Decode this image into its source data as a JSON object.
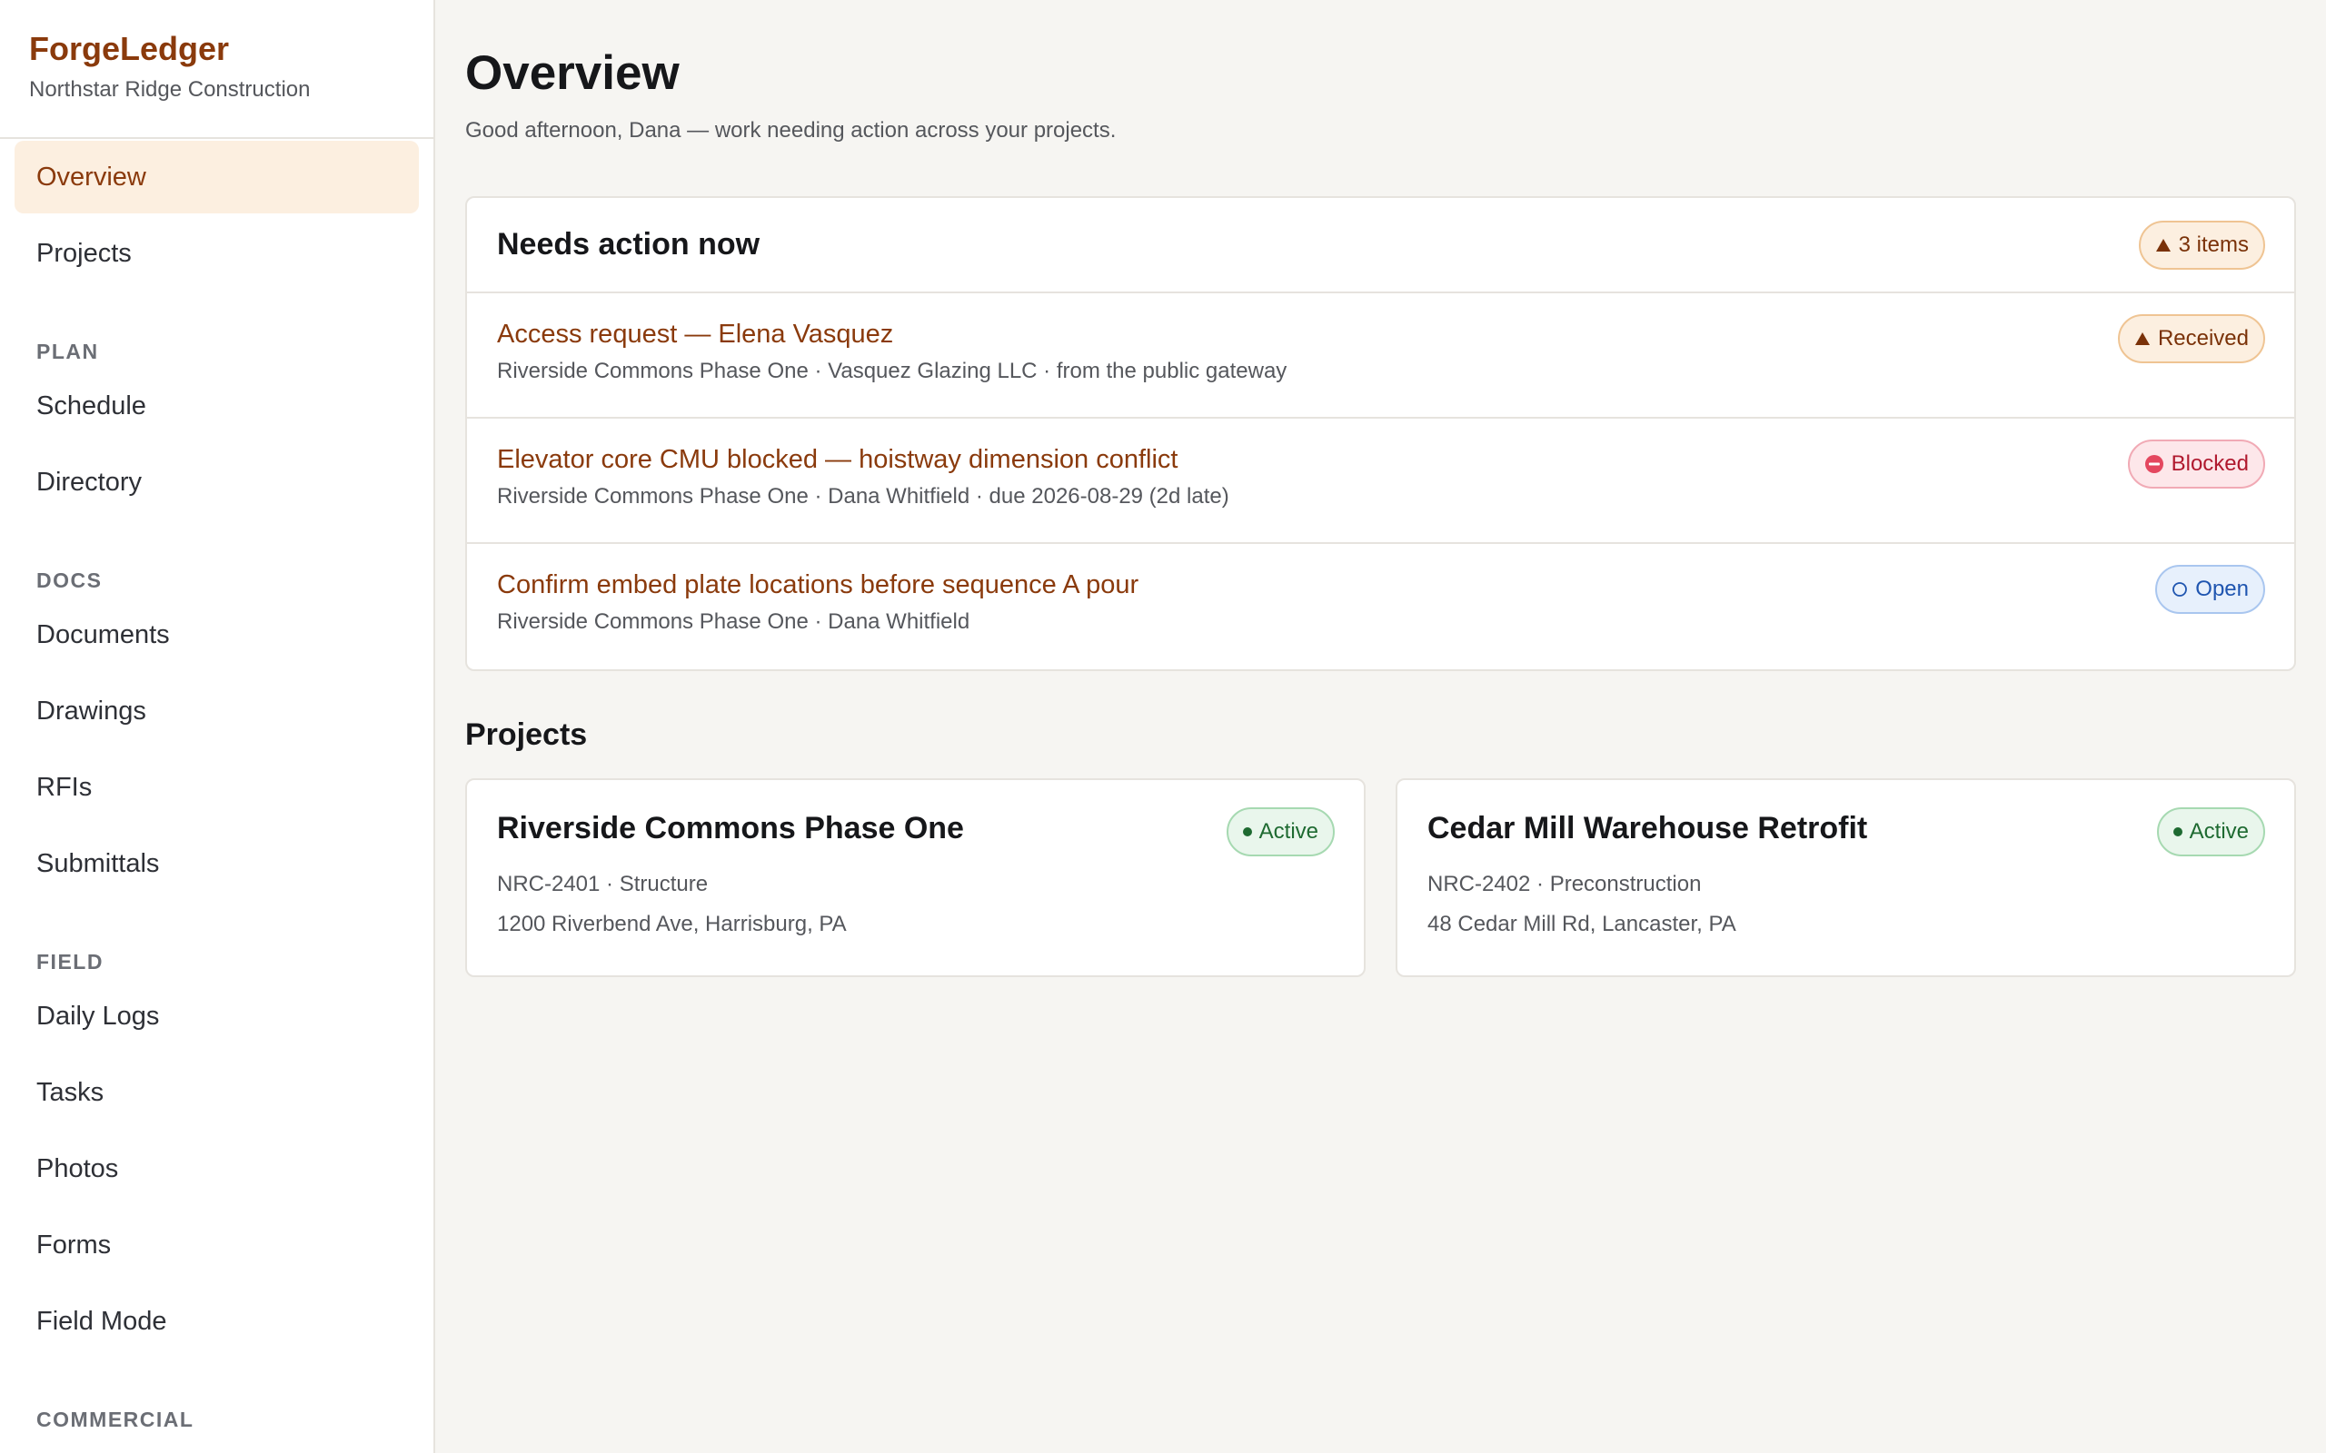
{
  "brand": {
    "name": "ForgeLedger",
    "org": "Northstar Ridge Construction"
  },
  "nav": {
    "overview": "Overview",
    "projects": "Projects",
    "section_plan": "PLAN",
    "schedule": "Schedule",
    "directory": "Directory",
    "section_docs": "DOCS",
    "documents": "Documents",
    "drawings": "Drawings",
    "rfis": "RFIs",
    "submittals": "Submittals",
    "section_field": "FIELD",
    "daily_logs": "Daily Logs",
    "tasks": "Tasks",
    "photos": "Photos",
    "forms": "Forms",
    "field_mode": "Field Mode",
    "section_commercial": "COMMERCIAL",
    "active_item": "Overview"
  },
  "page": {
    "title": "Overview",
    "subtitle": "Good afternoon, Dana — work needing action across your projects."
  },
  "action": {
    "title": "Needs action now",
    "count_badge": "3 items",
    "items": [
      {
        "title": "Access request — Elena Vasquez",
        "meta": "Riverside Commons Phase One · Vasquez Glazing LLC · from the public gateway",
        "status": "Received",
        "status_icon": "warning-triangle-icon"
      },
      {
        "title": "Elevator core CMU blocked — hoistway dimension conflict",
        "meta": "Riverside Commons Phase One · Dana Whitfield · due 2026-08-29 (2d late)",
        "status": "Blocked",
        "status_icon": "blocked-icon"
      },
      {
        "title": "Confirm embed plate locations before sequence A pour",
        "meta": "Riverside Commons Phase One · Dana Whitfield",
        "status": "Open",
        "status_icon": "open-circle-icon"
      }
    ]
  },
  "projects": {
    "title": "Projects",
    "items": [
      {
        "name": "Riverside Commons Phase One",
        "code": "NRC-2401 · Structure",
        "address": "1200 Riverbend Ave, Harrisburg, PA",
        "status": "Active"
      },
      {
        "name": "Cedar Mill Warehouse Retrofit",
        "code": "NRC-2402 · Preconstruction",
        "address": "48 Cedar Mill Rd, Lancaster, PA",
        "status": "Active"
      }
    ]
  },
  "colors": {
    "accent": "#8a3a0c",
    "accent_bg": "#fcefe0",
    "blocked": "#b0192e",
    "open": "#1f55b0",
    "active": "#1e6a31"
  }
}
